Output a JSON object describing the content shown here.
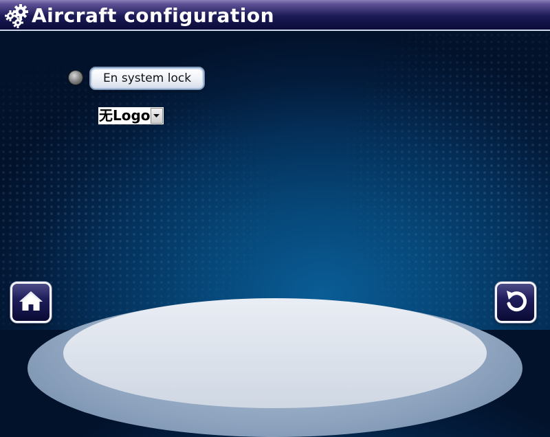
{
  "window": {
    "title": "Aircraft configuration",
    "title_icon": "gears-icon"
  },
  "lock": {
    "button_label": "En system lock",
    "radio_selected": false
  },
  "logo_select": {
    "selected": "无Logo"
  },
  "nav": {
    "home_icon": "home-icon",
    "back_icon": "back-arrow-icon"
  },
  "colors": {
    "title_bar": "#0b0b3a",
    "background": "#04305a",
    "button_face": "#ffffff"
  }
}
